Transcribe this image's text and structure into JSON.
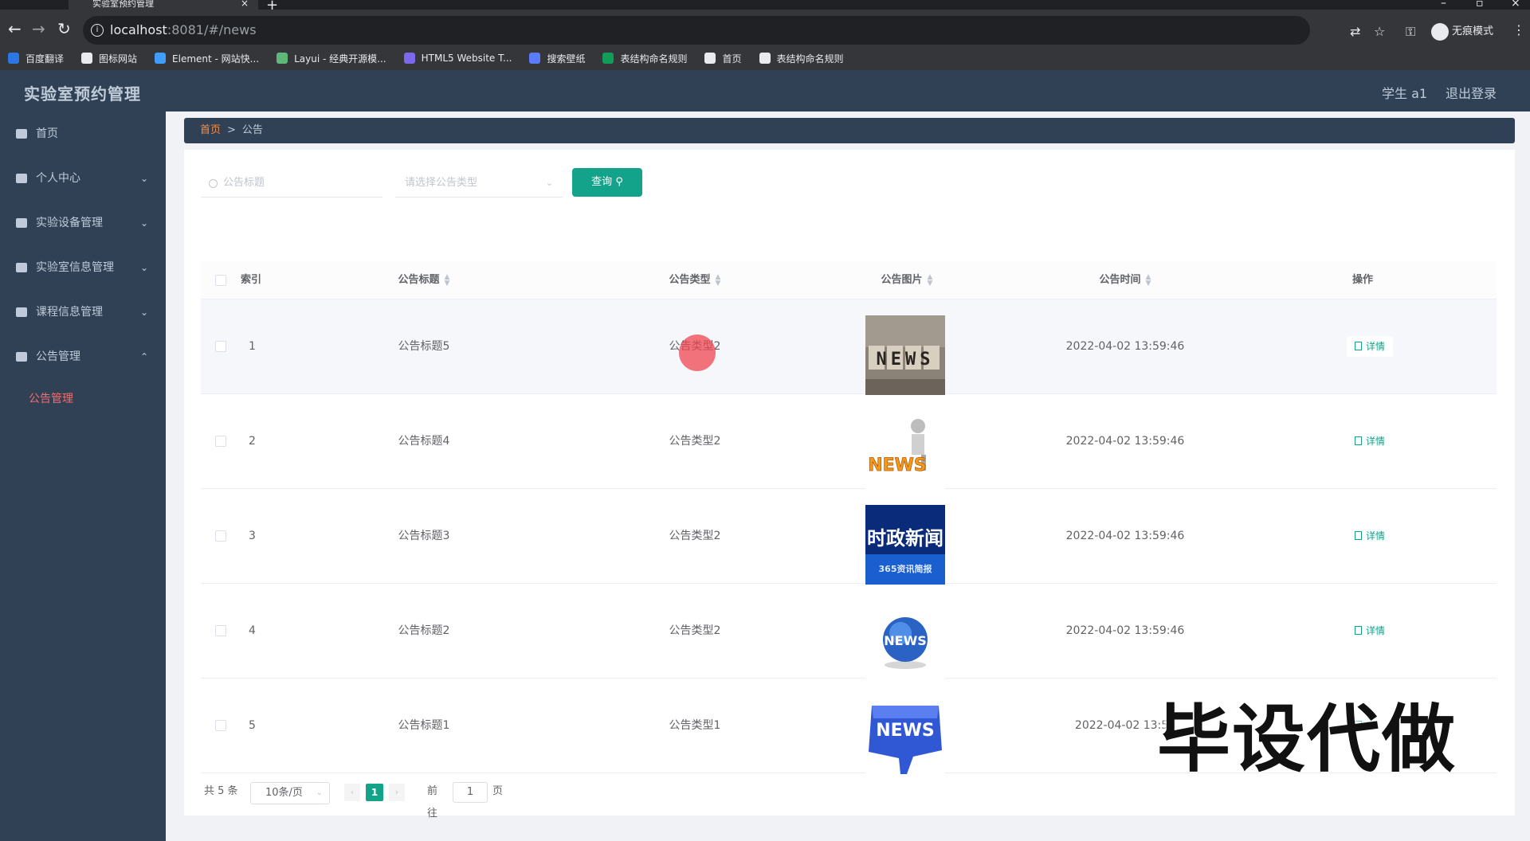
{
  "browser": {
    "tab_title": "实验室预约管理",
    "url_host": "localhost",
    "url_rest": ":8081/#/news",
    "incognito_label": "无痕模式",
    "bookmarks": [
      {
        "label": "百度翻译",
        "color": "#2b78e4"
      },
      {
        "label": "图标网站",
        "color": "#e8eaed"
      },
      {
        "label": "Element - 网站快...",
        "color": "#409eff"
      },
      {
        "label": "Layui - 经典开源模...",
        "color": "#5fb878"
      },
      {
        "label": "HTML5 Website T...",
        "color": "#7b68ee"
      },
      {
        "label": "搜索壁纸",
        "color": "#5b7cfa"
      },
      {
        "label": "表结构命名规则",
        "color": "#0f9d58"
      },
      {
        "label": "首页",
        "color": "#e8eaed"
      },
      {
        "label": "表结构命名规则",
        "color": "#e8eaed"
      }
    ]
  },
  "header": {
    "title": "实验室预约管理",
    "user": "学生 a1",
    "logout": "退出登录"
  },
  "sidebar": {
    "items": [
      {
        "label": "首页",
        "arrow": ""
      },
      {
        "label": "个人中心",
        "arrow": "⌄"
      },
      {
        "label": "实验设备管理",
        "arrow": "⌄"
      },
      {
        "label": "实验室信息管理",
        "arrow": "⌄"
      },
      {
        "label": "课程信息管理",
        "arrow": "⌄"
      },
      {
        "label": "公告管理",
        "arrow": "⌃"
      }
    ],
    "active_sub": "公告管理"
  },
  "breadcrumb": {
    "home": "首页",
    "separator": ">",
    "current": "公告"
  },
  "search": {
    "title_placeholder": "公告标题",
    "type_placeholder": "请选择公告类型",
    "query_label": "查询"
  },
  "table": {
    "headers": {
      "index": "索引",
      "title": "公告标题",
      "type": "公告类型",
      "image": "公告图片",
      "time": "公告时间",
      "action": "操作"
    },
    "rows": [
      {
        "index": "1",
        "title": "公告标题5",
        "type": "公告类型2",
        "time": "2022-04-02 13:59:46",
        "action": "详情",
        "image": "news-blocks-image"
      },
      {
        "index": "2",
        "title": "公告标题4",
        "type": "公告类型2",
        "time": "2022-04-02 13:59:46",
        "action": "详情",
        "image": "news-figure-image"
      },
      {
        "index": "3",
        "title": "公告标题3",
        "type": "公告类型2",
        "time": "2022-04-02 13:59:46",
        "action": "详情",
        "image": "politics-news-image"
      },
      {
        "index": "4",
        "title": "公告标题2",
        "type": "公告类型2",
        "time": "2022-04-02 13:59:46",
        "action": "详情",
        "image": "news-globe-image"
      },
      {
        "index": "5",
        "title": "公告标题1",
        "type": "公告类型1",
        "time": "2022-04-02 13:59",
        "action": "详",
        "image": "news-key-image"
      }
    ]
  },
  "image_text": {
    "row1": "NEWS",
    "row2": "NEWS",
    "row3_main": "时政新闻",
    "row3_sub": "365资讯简报",
    "row4": "NEWS",
    "row5": "NEWS"
  },
  "pagination": {
    "total": "共 5 条",
    "page_size": "10条/页",
    "current_page": "1",
    "goto_label": "前往",
    "goto_value": "1",
    "page_suffix": "页"
  },
  "watermark": "毕设代做",
  "colors": {
    "sidebar_bg": "#304156",
    "accent": "#13a28a",
    "active_menu": "#f56c6c"
  }
}
